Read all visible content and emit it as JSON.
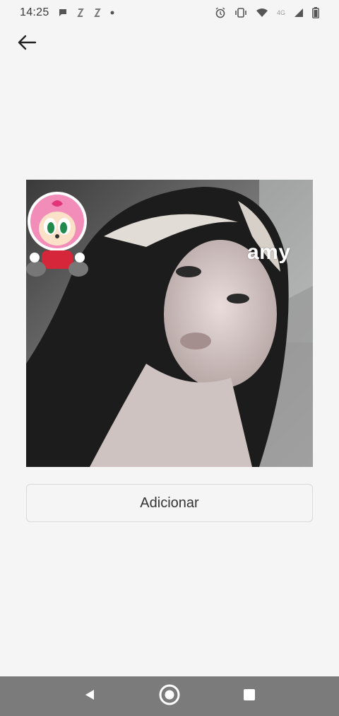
{
  "status_bar": {
    "time": "14:25",
    "network_label": "4G",
    "icons": [
      "chat-bubble-icon",
      "app-notification-icon",
      "app-notification-icon",
      "dot-icon",
      "alarm-icon",
      "vibrate-icon",
      "wifi-icon",
      "signal-icon",
      "battery-icon"
    ]
  },
  "header": {
    "back_icon": "arrow-left-icon"
  },
  "sticker": {
    "caption": "amy",
    "mascot_icon": "pink-hedgehog-sticker-icon"
  },
  "actions": {
    "add_label": "Adicionar"
  },
  "nav_bar": {
    "icons": [
      "back-triangle-icon",
      "home-circle-icon",
      "recents-square-icon"
    ]
  },
  "colors": {
    "background": "#f6f5f6",
    "nav_bar": "#7b7b7b",
    "button_border": "#d9d9d9",
    "caption": "#ffffff"
  }
}
